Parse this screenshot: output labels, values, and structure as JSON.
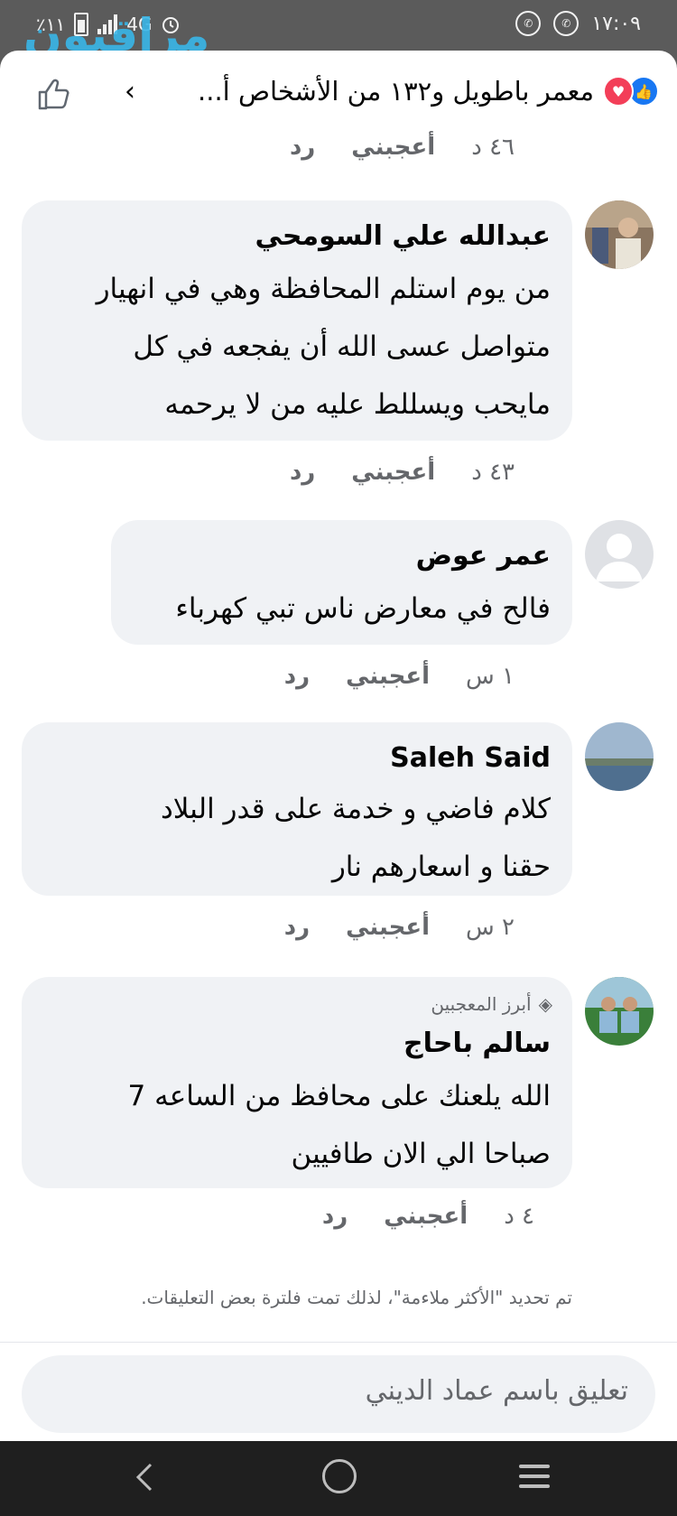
{
  "status_bar": {
    "time": "١٧:٠٩",
    "battery": "٪١١",
    "network": "4G"
  },
  "watermark": "مراقبون",
  "header": {
    "reactions_summary": "معمر باطويل و١٣٢ من الأشخاص أ...",
    "chevron": "›"
  },
  "actions": {
    "like": "أعجبني",
    "reply": "رد"
  },
  "first_meta_time": "٤٦ د",
  "comments": [
    {
      "author": "عبدالله علي السومحي",
      "lines": [
        "من يوم استلم المحافظة وهي في انهيار",
        "متواصل عسى الله أن يفجعه في كل",
        "مايحب ويسللط عليه من لا يرحمه"
      ],
      "time": "٤٣ د"
    },
    {
      "author": "عمر عوض",
      "lines": [
        "فالح في معارض ناس تبي كهرباء"
      ],
      "time": "١ س"
    },
    {
      "author": "Saleh Said",
      "lines": [
        "كلام فاضي و خدمة على قدر البلاد",
        "حقنا و اسعارهم نار"
      ],
      "time": "٢ س"
    },
    {
      "author": "سالم باحاج",
      "badge": "أبرز المعجبين",
      "lines": [
        "الله يلعنك على محافظ من الساعه 7",
        "صباحا الي الان طافيين"
      ],
      "time": "٤ د"
    }
  ],
  "filter_notice": "تم تحديد \"الأكثر ملاءمة\"، لذلك تمت فلترة بعض التعليقات.",
  "composer": {
    "placeholder": "تعليق باسم عماد الديني"
  },
  "colors": {
    "accent": "#1877f2",
    "bubble": "#f0f2f5",
    "meta": "#65676b"
  }
}
